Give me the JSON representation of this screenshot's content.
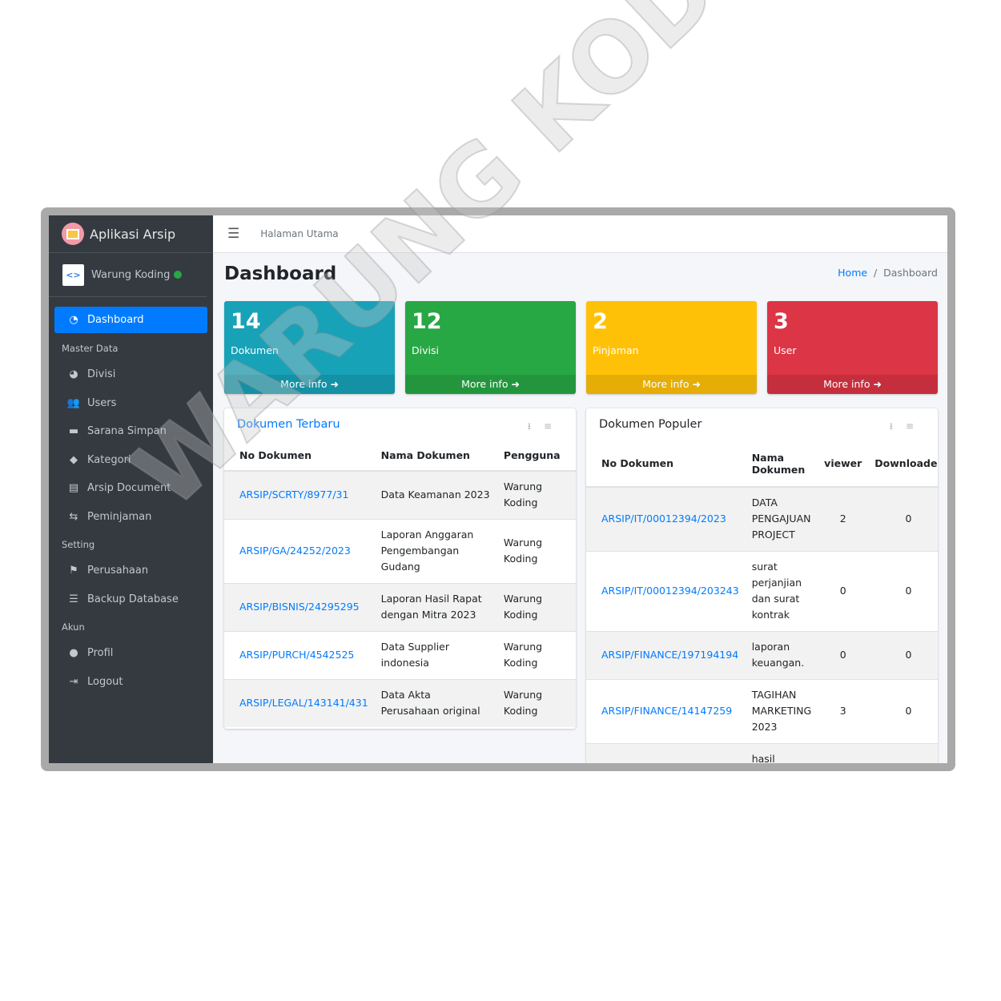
{
  "app": {
    "title": "Aplikasi Arsip",
    "user": "Warung Koding"
  },
  "sidebar": {
    "items": [
      {
        "label": "Dashboard",
        "icon": "tachometer-icon",
        "active": true
      },
      {
        "header": "Master Data"
      },
      {
        "label": "Divisi",
        "icon": "chart-pie-icon"
      },
      {
        "label": "Users",
        "icon": "users-icon"
      },
      {
        "label": "Sarana Simpan",
        "icon": "archive-icon"
      },
      {
        "label": "Kategori",
        "icon": "tag-icon"
      },
      {
        "label": "Arsip Document",
        "icon": "file-icon"
      },
      {
        "label": "Peminjaman",
        "icon": "handshake-icon"
      },
      {
        "header": "Setting"
      },
      {
        "label": "Perusahaan",
        "icon": "flag-icon"
      },
      {
        "label": "Backup Database",
        "icon": "database-icon"
      },
      {
        "header": "Akun"
      },
      {
        "label": "Profil",
        "icon": "user-icon"
      },
      {
        "label": "Logout",
        "icon": "sign-out-icon"
      }
    ]
  },
  "topbar": {
    "link": "Halaman Utama"
  },
  "page": {
    "title": "Dashboard",
    "breadcrumb": [
      "Home",
      "Dashboard"
    ]
  },
  "stats": [
    {
      "value": "14",
      "label": "Dokumen",
      "more": "More info",
      "color": "#17a2b8"
    },
    {
      "value": "12",
      "label": "Divisi",
      "more": "More info",
      "color": "#28a745"
    },
    {
      "value": "2",
      "label": "Pinjaman",
      "more": "More info",
      "color": "#ffc107"
    },
    {
      "value": "3",
      "label": "User",
      "more": "More info",
      "color": "#dc3545"
    }
  ],
  "recent": {
    "title": "Dokumen Terbaru",
    "headers": [
      "No Dokumen",
      "Nama Dokumen",
      "Pengguna"
    ],
    "rows": [
      [
        "ARSIP/SCRTY/8977/31",
        "Data Keamanan 2023",
        "Warung Koding"
      ],
      [
        "ARSIP/GA/24252/2023",
        "Laporan Anggaran Pengembangan Gudang",
        "Warung Koding"
      ],
      [
        "ARSIP/BISNIS/24295295",
        "Laporan Hasil Rapat dengan Mitra 2023",
        "Warung Koding"
      ],
      [
        "ARSIP/PURCH/4542525",
        "Data Supplier indonesia",
        "Warung Koding"
      ],
      [
        "ARSIP/LEGAL/143141/431",
        "Data Akta Perusahaan original",
        "Warung Koding"
      ]
    ]
  },
  "popular": {
    "title": "Dokumen Populer",
    "headers": [
      "No Dokumen",
      "Nama Dokumen",
      "viewer",
      "Downloader"
    ],
    "rows": [
      [
        "ARSIP/IT/00012394/2023",
        "DATA PENGAJUAN PROJECT",
        "2",
        "0"
      ],
      [
        "ARSIP/IT/00012394/203243",
        "surat perjanjian dan surat kontrak",
        "0",
        "0"
      ],
      [
        "ARSIP/FINANCE/197194194",
        "laporan keuangan.",
        "0",
        "0"
      ],
      [
        "ARSIP/FINANCE/14147259",
        "TAGIHAN MARKETING 2023",
        "3",
        "0"
      ],
      [
        "",
        "hasil",
        "",
        ""
      ]
    ]
  },
  "watermark": "WARUNG KODING"
}
